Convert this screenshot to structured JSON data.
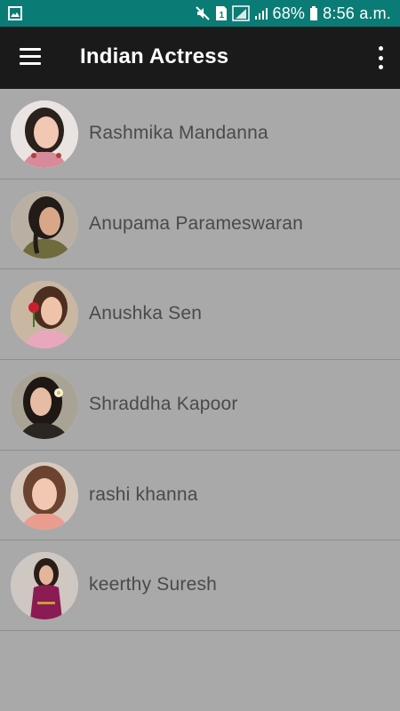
{
  "status_bar": {
    "battery": "68%",
    "time": "8:56 a.m.",
    "icons": [
      "image-icon",
      "mute-icon",
      "sim-icon",
      "signal-icon",
      "signal-icon",
      "battery-icon"
    ]
  },
  "app_bar": {
    "title": "Indian Actress",
    "menu_icon": "hamburger-menu-icon",
    "overflow_icon": "more-vert-icon"
  },
  "actresses": [
    {
      "name": "Rashmika Mandanna"
    },
    {
      "name": "Anupama Parameswaran"
    },
    {
      "name": "Anushka Sen"
    },
    {
      "name": "Shraddha Kapoor"
    },
    {
      "name": "rashi khanna"
    },
    {
      "name": "keerthy Suresh"
    }
  ],
  "colors": {
    "status_bar": "#0b7c75",
    "app_bar": "#1a1a1a",
    "background": "#a9a9a9",
    "divider": "#8e8e8e",
    "label_text": "#4a4a4a"
  }
}
